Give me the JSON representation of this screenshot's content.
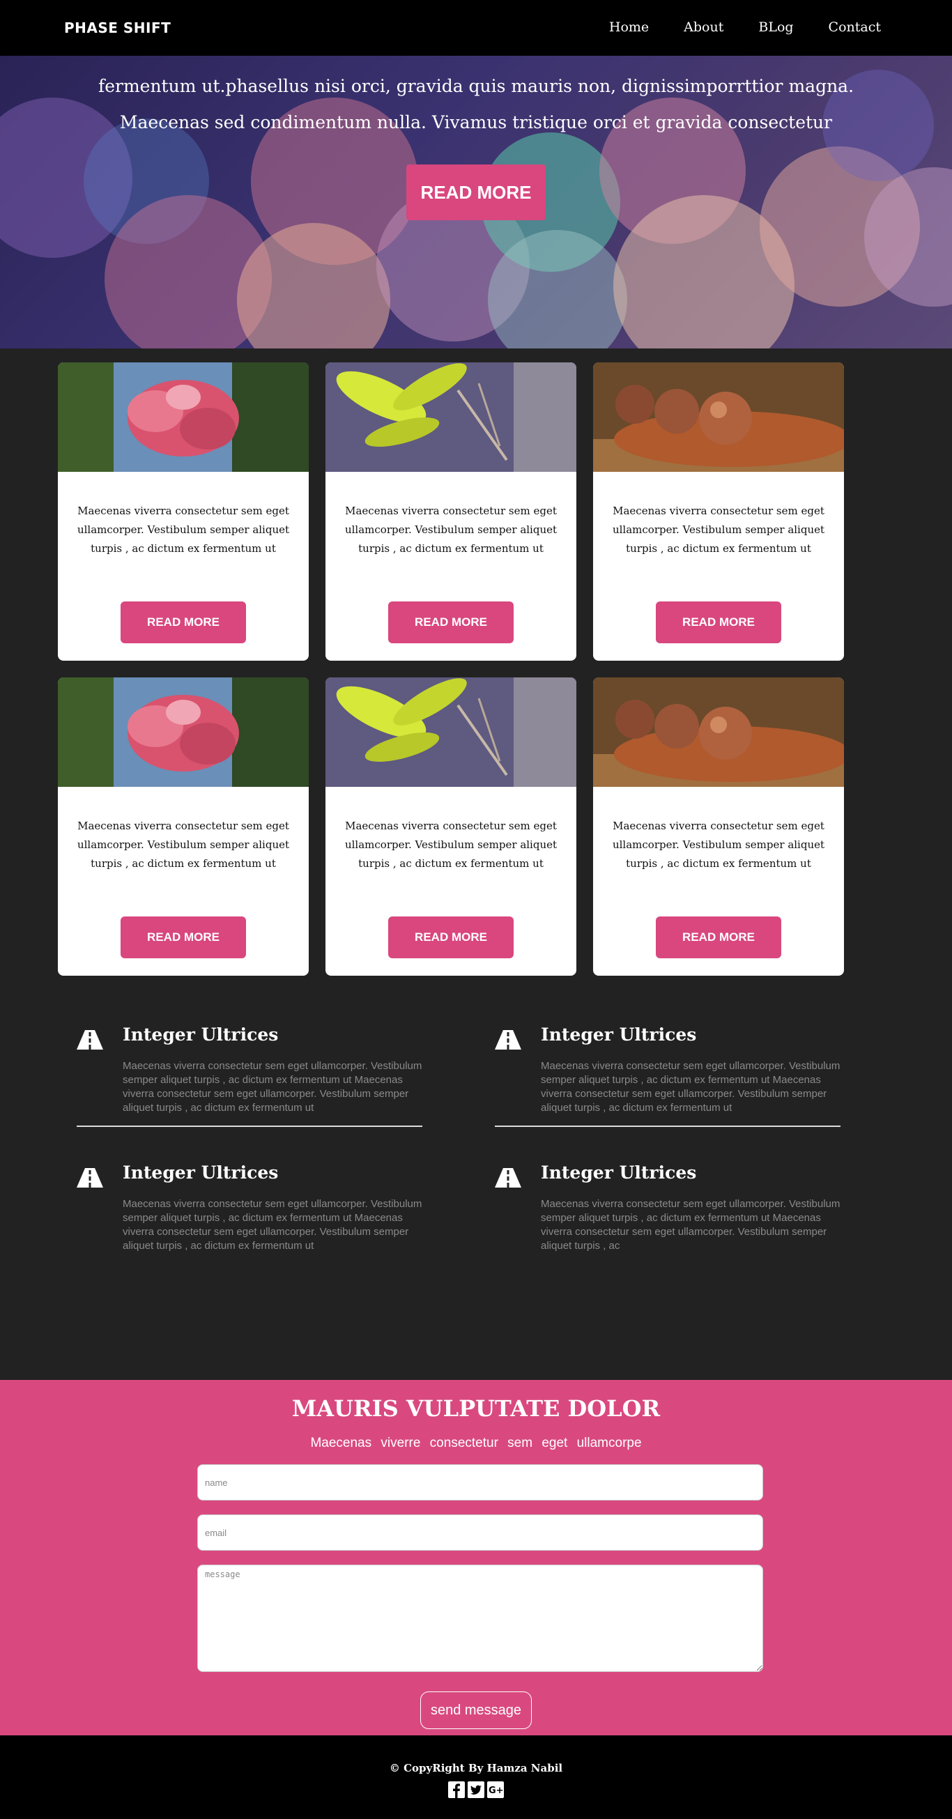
{
  "nav": {
    "brand": "PHASE SHIFT",
    "links": [
      "Home",
      "About",
      "BLog",
      "Contact"
    ]
  },
  "hero": {
    "text": "fermentum ut.phasellus nisi orci, gravida quis mauris non, dignissimporrttior magna. Maecenas sed condimentum nulla. Vivamus tristique orci et gravida consectetur",
    "button": "READ MORE"
  },
  "cards": [
    {
      "image": "pink-flower",
      "text": "Maecenas viverra consectetur sem eget ullamcorper. Vestibulum semper aliquet turpis , ac dictum ex fermentum ut",
      "button": "READ MORE"
    },
    {
      "image": "green-leaves",
      "text": "Maecenas viverra consectetur sem eget ullamcorper. Vestibulum semper aliquet turpis , ac dictum ex fermentum ut",
      "button": "READ MORE"
    },
    {
      "image": "brown-seeds",
      "text": "Maecenas viverra consectetur sem eget ullamcorper. Vestibulum semper aliquet turpis , ac dictum ex fermentum ut",
      "button": "READ MORE"
    },
    {
      "image": "pink-flower",
      "text": "Maecenas viverra consectetur sem eget ullamcorper. Vestibulum semper aliquet turpis , ac dictum ex fermentum ut",
      "button": "READ MORE"
    },
    {
      "image": "green-leaves",
      "text": "Maecenas viverra consectetur sem eget ullamcorper. Vestibulum semper aliquet turpis , ac dictum ex fermentum ut",
      "button": "READ MORE"
    },
    {
      "image": "brown-seeds",
      "text": "Maecenas viverra consectetur sem eget ullamcorper. Vestibulum semper aliquet turpis , ac dictum ex fermentum ut",
      "button": "READ MORE"
    }
  ],
  "features": [
    {
      "icon": "road-icon",
      "title": "Integer Ultrices",
      "text": "Maecenas viverra consectetur sem eget ullamcorper. Vestibulum semper aliquet turpis , ac dictum ex fermentum ut Maecenas viverra consectetur sem eget ullamcorper. Vestibulum semper aliquet turpis , ac dictum ex fermentum ut"
    },
    {
      "icon": "road-icon",
      "title": "Integer Ultrices",
      "text": "Maecenas viverra consectetur sem eget ullamcorper. Vestibulum semper aliquet turpis , ac dictum ex fermentum ut Maecenas viverra consectetur sem eget ullamcorper. Vestibulum semper aliquet turpis , ac dictum ex fermentum ut"
    },
    {
      "icon": "road-icon",
      "title": "Integer Ultrices",
      "text": "Maecenas viverra consectetur sem eget ullamcorper. Vestibulum semper aliquet turpis , ac dictum ex fermentum ut Maecenas viverra consectetur sem eget ullamcorper. Vestibulum semper aliquet turpis , ac dictum ex fermentum ut"
    },
    {
      "icon": "road-icon",
      "title": "Integer Ultrices",
      "text": "Maecenas viverra consectetur sem eget ullamcorper. Vestibulum semper aliquet turpis , ac dictum ex fermentum ut Maecenas viverra consectetur sem eget ullamcorper. Vestibulum semper aliquet turpis , ac"
    }
  ],
  "contact": {
    "title": "MAURIS VULPUTATE DOLOR",
    "subtitle": "Maecenas viverre consectetur sem eget ullamcorpe",
    "name_placeholder": "name",
    "email_placeholder": "email",
    "message_placeholder": "message",
    "send_label": "send message"
  },
  "footer": {
    "copyright": "© CopyRight By Hamza Nabil",
    "socials": [
      "facebook-icon",
      "twitter-icon",
      "google-plus-icon"
    ]
  },
  "colors": {
    "accent": "#d9477e",
    "dark_bg": "#222222",
    "nav_bg": "#000000"
  }
}
